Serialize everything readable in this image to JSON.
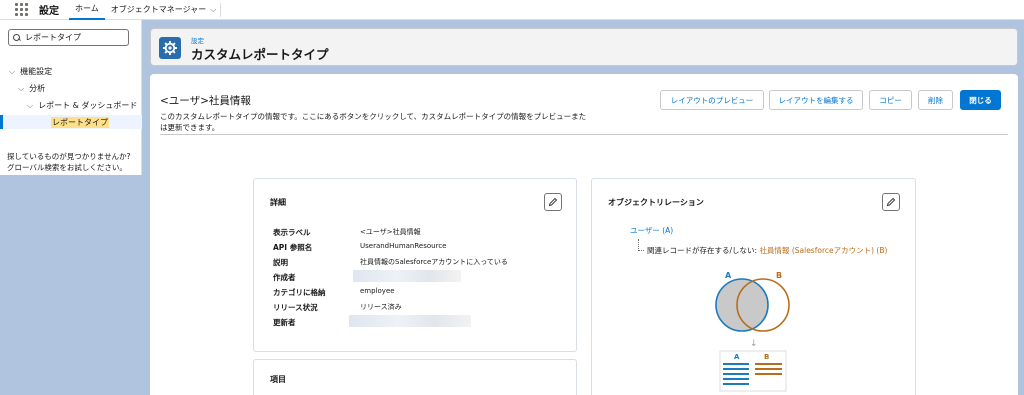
{
  "topbar": {
    "app_name": "設定",
    "tabs": [
      {
        "label": "ホーム"
      },
      {
        "label": "オブジェクトマネージャー"
      }
    ]
  },
  "sidebar": {
    "search_value": "レポートタイプ",
    "tree": [
      {
        "label": "機能設定"
      },
      {
        "label": "分析"
      },
      {
        "label": "レポート & ダッシュボード"
      },
      {
        "label": "レポートタイプ"
      }
    ],
    "not_found_line1": "探しているものが見つかりませんか?",
    "not_found_line2": "グローバル検索をお試しください。"
  },
  "header": {
    "crumb": "設定",
    "title": "カスタムレポートタイプ"
  },
  "detail": {
    "title": "<ユーザ>社員情報",
    "description_line1": "このカスタムレポートタイプの情報です。ここにあるボタンをクリックして、カスタムレポートタイプの情報をプレビューまた",
    "description_line2": "は更新できます。",
    "buttons": {
      "preview": "レイアウトのプレビュー",
      "edit_layout": "レイアウトを編集する",
      "copy": "コピー",
      "delete": "削除",
      "close": "閉じる"
    }
  },
  "details_section": {
    "title": "詳細",
    "fields": [
      {
        "label": "表示ラベル",
        "value": "<ユーザ>社員情報"
      },
      {
        "label": "API 参照名",
        "value": "UserandHumanResource"
      },
      {
        "label": "説明",
        "value": "社員情報のSalesforceアカウントに入っている"
      },
      {
        "label": "作成者",
        "value": ""
      },
      {
        "label": "カテゴリに格納",
        "value": "employee"
      },
      {
        "label": "リリース状況",
        "value": "リリース済み"
      },
      {
        "label": "更新者",
        "value": ""
      }
    ]
  },
  "fields_section": {
    "title": "項目"
  },
  "relation_section": {
    "title": "オブジェクトリレーション",
    "root": "ユーザー (A)",
    "child_prefix": "関連レコードが存在する/しない: ",
    "child_link": "社員情報 (Salesforceアカウント) (B)",
    "venn_a": "A",
    "venn_b": "B",
    "table_a": "A",
    "table_b": "B",
    "colors": {
      "a": "#1b7bbd",
      "b": "#b86d1b"
    }
  },
  "colors": {
    "brand": "#0176d3",
    "background": "#b0c4df"
  }
}
